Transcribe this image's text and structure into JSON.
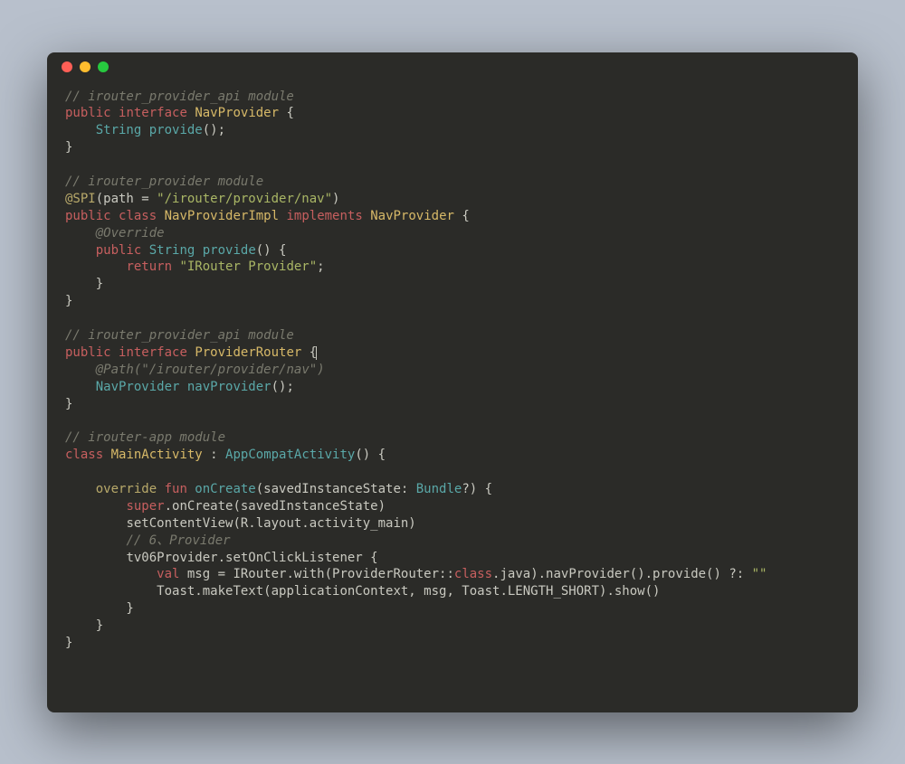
{
  "window": {
    "dots": [
      "close",
      "minimize",
      "maximize"
    ]
  },
  "code": {
    "l1_comment": "// irouter_provider_api module",
    "l2_public": "public",
    "l2_interface": "interface",
    "l2_name": "NavProvider",
    "l2_brace": " {",
    "l3_indent": "    ",
    "l3_type": "String",
    "l3_method": " provide",
    "l3_rest": "();",
    "l4": "}",
    "l6_comment": "// irouter_provider module",
    "l7_at": "@SPI",
    "l7_rest1": "(path = ",
    "l7_str": "\"/irouter/provider/nav\"",
    "l7_rest2": ")",
    "l8_public": "public",
    "l8_class": "class",
    "l8_name": "NavProviderImpl",
    "l8_implements": "implements",
    "l8_iface": "NavProvider",
    "l8_brace": " {",
    "l9_indent": "    ",
    "l9_override": "@Override",
    "l10_indent": "    ",
    "l10_public": "public",
    "l10_type": "String",
    "l10_method": " provide",
    "l10_rest": "() {",
    "l11_indent": "        ",
    "l11_return": "return",
    "l11_str": " \"IRouter Provider\"",
    "l11_semi": ";",
    "l12": "    }",
    "l13": "}",
    "l15_comment": "// irouter_provider_api module",
    "l16_public": "public",
    "l16_interface": "interface",
    "l16_name": "ProviderRouter",
    "l16_brace": " {",
    "l17_indent": "    ",
    "l17_ann": "@Path",
    "l17_paren": "(",
    "l17_str": "\"/irouter/provider/nav\"",
    "l17_paren2": ")",
    "l18_indent": "    ",
    "l18_type": "NavProvider",
    "l18_method": " navProvider",
    "l18_rest": "();",
    "l19": "}",
    "l21_comment": "// irouter-app module",
    "l22_class": "class",
    "l22_name": "MainActivity",
    "l22_colon": " : ",
    "l22_parent": "AppCompatActivity",
    "l22_rest": "() {",
    "l24_indent": "    ",
    "l24_override": "override",
    "l24_fun": " fun",
    "l24_method": " onCreate",
    "l24_rest1": "(savedInstanceState: ",
    "l24_type": "Bundle",
    "l24_rest2": "?) {",
    "l25_indent": "        ",
    "l25_super": "super",
    "l25_rest": ".onCreate(savedInstanceState)",
    "l26_indent": "        ",
    "l26_rest": "setContentView(R.layout.activity_main)",
    "l27_indent": "        ",
    "l27_comment": "// 6、Provider",
    "l28_indent": "        ",
    "l28_rest": "tv06Provider.setOnClickListener {",
    "l29_indent": "            ",
    "l29_val": "val",
    "l29_rest1": " msg = IRouter.with(ProviderRouter::",
    "l29_class": "class",
    "l29_rest2": ".java).navProvider().provide() ?: ",
    "l29_str": "\"\"",
    "l30_indent": "            ",
    "l30_rest": "Toast.makeText(applicationContext, msg, Toast.LENGTH_SHORT).show()",
    "l31": "        }",
    "l32": "    }",
    "l33": "}"
  }
}
